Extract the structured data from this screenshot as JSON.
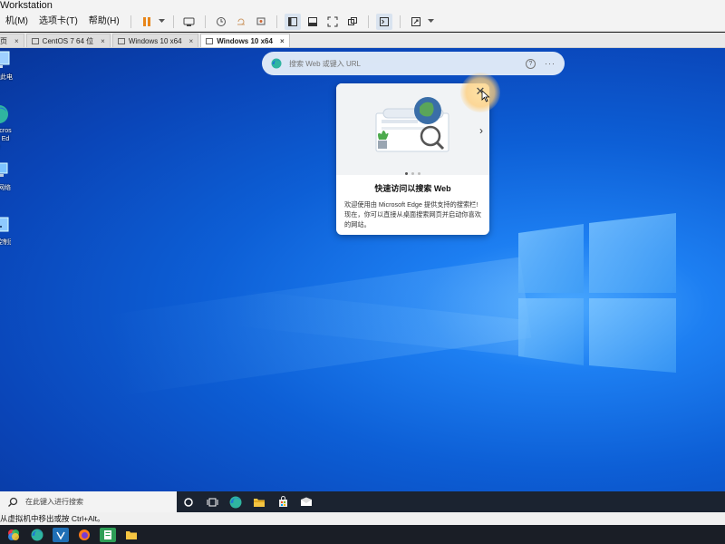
{
  "window": {
    "title": "Workstation"
  },
  "menu": [
    "机(M)",
    "选项卡(T)",
    "帮助(H)"
  ],
  "tabs": [
    {
      "label": "页",
      "active": false
    },
    {
      "label": "CentOS 7 64 位",
      "active": false
    },
    {
      "label": "Windows 10 x64",
      "active": false
    },
    {
      "label": "Windows 10 x64",
      "active": true
    }
  ],
  "desktop_icons": [
    {
      "label": "此电脑",
      "icon": "computer-icon"
    },
    {
      "label": "Microsoft Edge",
      "icon": "edge-icon"
    },
    {
      "label": "网络",
      "icon": "network-icon"
    },
    {
      "label": "控制面板",
      "icon": "control-panel-icon"
    }
  ],
  "web_search": {
    "placeholder": "搜索 Web 或键入 URL"
  },
  "card": {
    "title": "快速访问以搜索 Web",
    "body": "欢迎使用由 Microsoft Edge 提供支持的搜索栏! 现在，你可以直接从桌面搜索网页并启动你喜欢的网站。",
    "pages": 3,
    "current_page": 1
  },
  "taskbar": {
    "search_placeholder": "在此键入进行搜索"
  },
  "statusbar": {
    "text": "从虚拟机中移出或按 Ctrl+Alt。"
  },
  "colors": {
    "desktop_blue": "#0d5fd6",
    "taskbar": "#1b2330",
    "accent": "#0078d7"
  }
}
